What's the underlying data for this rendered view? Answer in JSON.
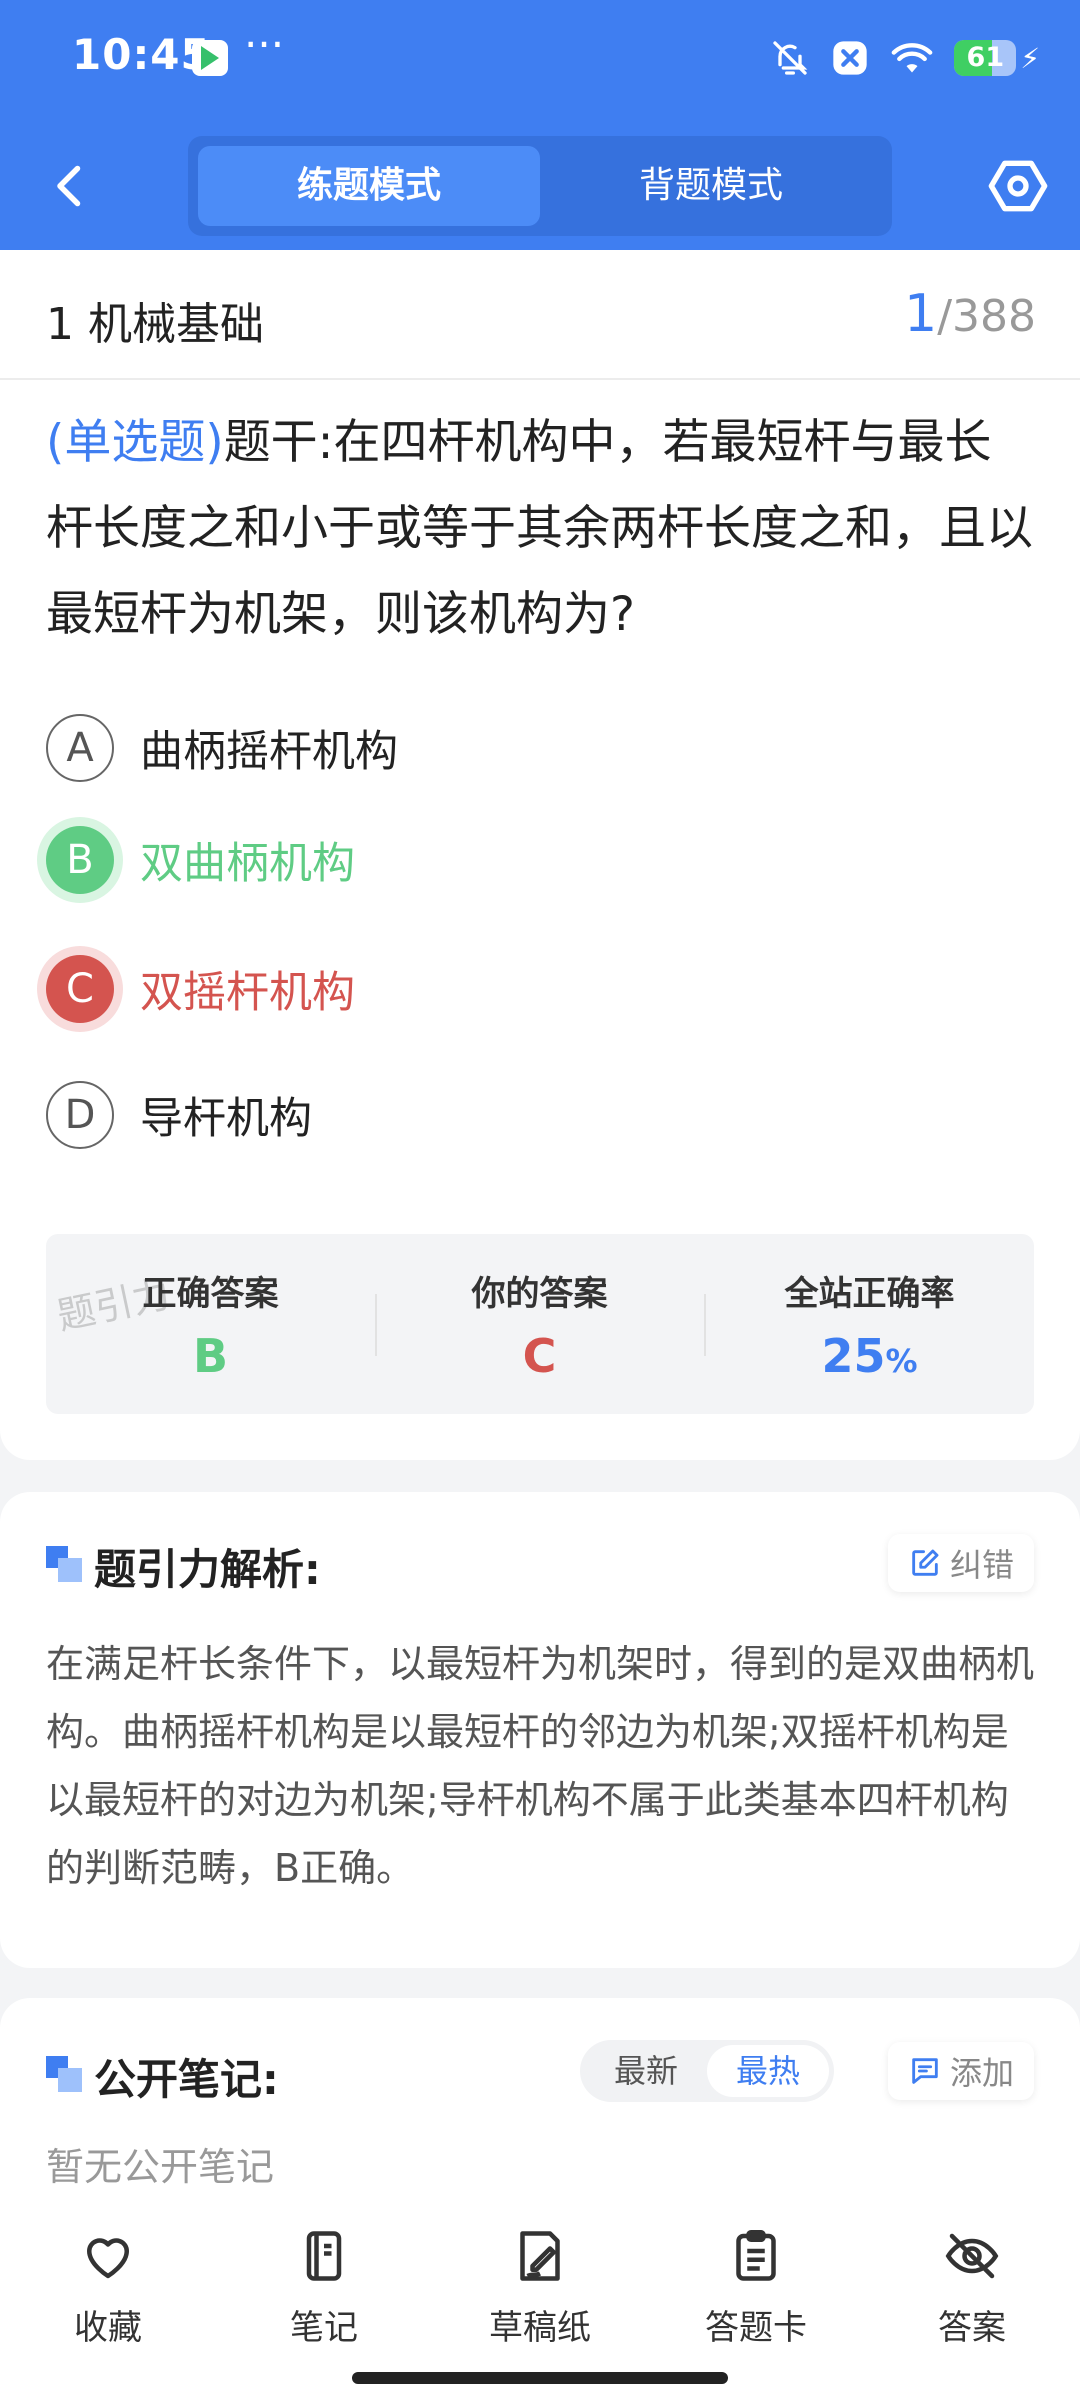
{
  "status_bar": {
    "time": "10:45",
    "more": "···",
    "battery_level": "61",
    "battery_fraction": 0.61,
    "icons": [
      "app-icon",
      "mute-icon",
      "notification-x-icon",
      "wifi-icon",
      "battery-icon",
      "charging-icon"
    ]
  },
  "nav": {
    "tabs": [
      {
        "label": "练题模式",
        "active": true
      },
      {
        "label": "背题模式",
        "active": false
      }
    ]
  },
  "question_header": {
    "chapter": "1 机械基础",
    "current": "1",
    "total": "/388"
  },
  "question": {
    "type": "(单选题)",
    "text": "题干:在四杆机构中，若最短杆与最长杆长度之和小于或等于其余两杆长度之和，且以最短杆为机架，则该机构为?"
  },
  "options": [
    {
      "letter": "A",
      "text": "曲柄摇杆机构",
      "state": "normal"
    },
    {
      "letter": "B",
      "text": "双曲柄机构",
      "state": "correct"
    },
    {
      "letter": "C",
      "text": "双摇杆机构",
      "state": "wrong"
    },
    {
      "letter": "D",
      "text": "导杆机构",
      "state": "normal"
    }
  ],
  "stats": {
    "correct_label": "正确答案",
    "correct_value": "B",
    "yours_label": "你的答案",
    "yours_value": "C",
    "rate_label": "全站正确率",
    "rate_value": "25",
    "rate_unit": "%",
    "watermark": "题引力"
  },
  "analysis": {
    "title": "题引力解析:",
    "report_label": "纠错",
    "text": "在满足杆长条件下，以最短杆为机架时，得到的是双曲柄机构。曲柄摇杆机构是以最短杆的邻边为机架;双摇杆机构是以最短杆的对边为机架;导杆机构不属于此类基本四杆机构的判断范畴，B正确。"
  },
  "notes": {
    "title": "公开笔记:",
    "sort_latest": "最新",
    "sort_hot": "最热",
    "add_label": "添加",
    "empty_text": "暂无公开笔记"
  },
  "bottom_bar": [
    {
      "label": "收藏",
      "icon": "heart-icon"
    },
    {
      "label": "笔记",
      "icon": "notebook-icon"
    },
    {
      "label": "草稿纸",
      "icon": "draft-paper-icon"
    },
    {
      "label": "答题卡",
      "icon": "answer-card-icon"
    },
    {
      "label": "答案",
      "icon": "eye-off-icon"
    }
  ],
  "colors": {
    "primary": "#3f7ef1",
    "correct": "#5fcc84",
    "wrong": "#d4544f"
  }
}
